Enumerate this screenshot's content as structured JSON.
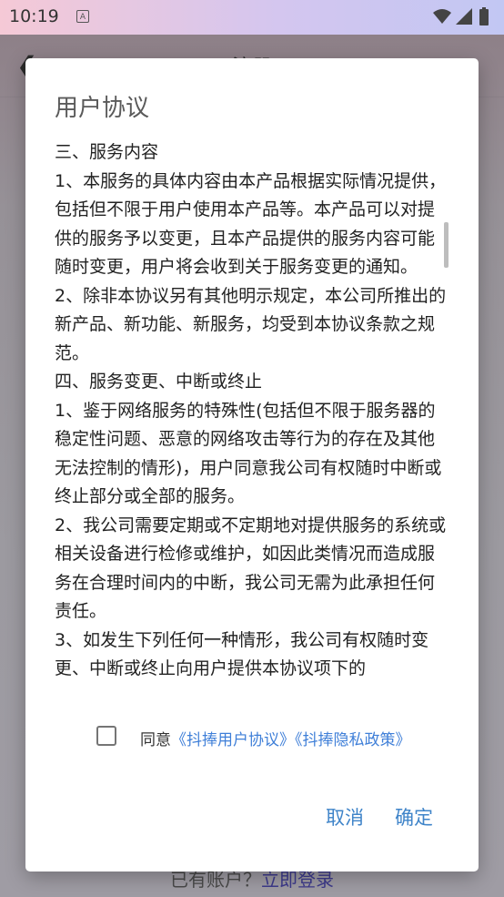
{
  "status_bar": {
    "time": "10:19",
    "app_icon_glyph": "A",
    "icons": [
      "wifi-icon",
      "signal-icon",
      "battery-icon"
    ]
  },
  "background": {
    "title": "注册",
    "back_icon": "back-arrow-icon",
    "login_prompt": "已有账户？",
    "login_link": "立即登录"
  },
  "dialog": {
    "title": "用户协议",
    "content": [
      "三、服务内容",
      "1、本服务的具体内容由本产品根据实际情况提供，包括但不限于用户使用本产品等。本产品可以对提供的服务予以变更，且本产品提供的服务内容可能随时变更，用户将会收到关于服务变更的通知。",
      "2、除非本协议另有其他明示规定，本公司所推出的新产品、新功能、新服务，均受到本协议条款之规范。",
      "四、服务变更、中断或终止",
      "1、鉴于网络服务的特殊性(包括但不限于服务器的稳定性问题、恶意的网络攻击等行为的存在及其他无法控制的情形)，用户同意我公司有权随时中断或终止部分或全部的服务。",
      "2、我公司需要定期或不定期地对提供服务的系统或相关设备进行检修或维护，如因此类情况而造成服务在合理时间内的中断，我公司无需为此承担任何责任。",
      "3、如发生下列任何一种情形，我公司有权随时变更、中断或终止向用户提供本协议项下的"
    ],
    "agree_prefix": "同意",
    "agree_link_1": "《抖捧用户协议》",
    "agree_link_2": "《抖捧隐私政策》",
    "cancel_label": "取消",
    "confirm_label": "确定"
  },
  "colors": {
    "accent": "#3f84c9",
    "link": "#3f7fd8"
  }
}
